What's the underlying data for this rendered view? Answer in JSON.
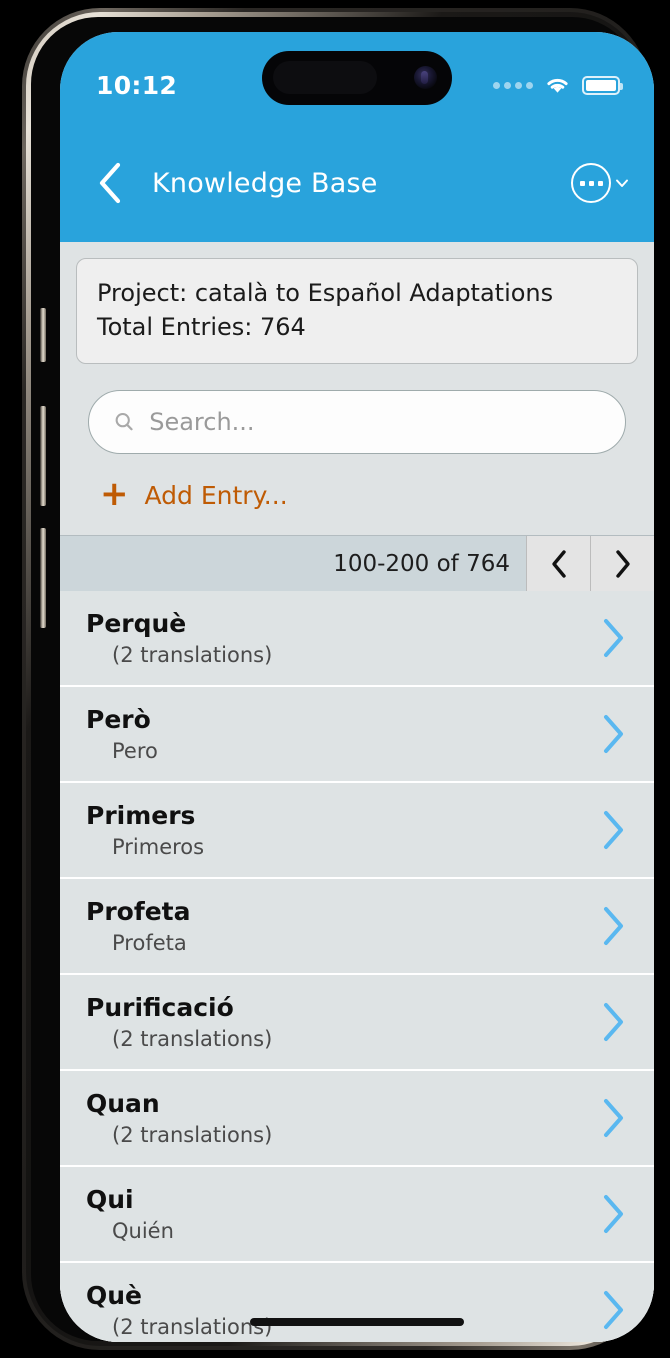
{
  "status_bar": {
    "time": "10:12",
    "signal_icon": "signal-dots-icon",
    "wifi_icon": "wifi-icon",
    "battery_icon": "battery-full-icon"
  },
  "nav": {
    "back_icon": "chevron-left-icon",
    "title": "Knowledge Base",
    "menu_icon": "ellipsis-circle-icon",
    "menu_chevron_icon": "chevron-down-icon"
  },
  "project_card": {
    "project_line": "Project: català to Español Adaptations",
    "entries_line": "Total Entries: 764"
  },
  "search": {
    "placeholder": "Search...",
    "value": "",
    "icon": "search-icon"
  },
  "add_entry": {
    "plus": "+",
    "label": "Add Entry..."
  },
  "pagination": {
    "range": "100-200 of 764",
    "prev_icon": "chevron-left-icon",
    "next_icon": "chevron-right-icon"
  },
  "entries": [
    {
      "term": "Perquè",
      "subtitle": "(2 translations)",
      "chevron": "chevron-right-icon"
    },
    {
      "term": "Però",
      "subtitle": "Pero",
      "chevron": "chevron-right-icon"
    },
    {
      "term": "Primers",
      "subtitle": "Primeros",
      "chevron": "chevron-right-icon"
    },
    {
      "term": "Profeta",
      "subtitle": "Profeta",
      "chevron": "chevron-right-icon"
    },
    {
      "term": "Purificació",
      "subtitle": "(2 translations)",
      "chevron": "chevron-right-icon"
    },
    {
      "term": "Quan",
      "subtitle": "(2 translations)",
      "chevron": "chevron-right-icon"
    },
    {
      "term": "Qui",
      "subtitle": "Quién",
      "chevron": "chevron-right-icon"
    },
    {
      "term": "Què",
      "subtitle": "(2 translations)",
      "chevron": "chevron-right-icon"
    }
  ],
  "colors": {
    "header_blue": "#29a3dc",
    "accent_orange": "#bf5b04",
    "chevron_blue": "#5ab8f0",
    "row_bg": "#dee3e4",
    "pager_bg": "#ccd6da"
  }
}
